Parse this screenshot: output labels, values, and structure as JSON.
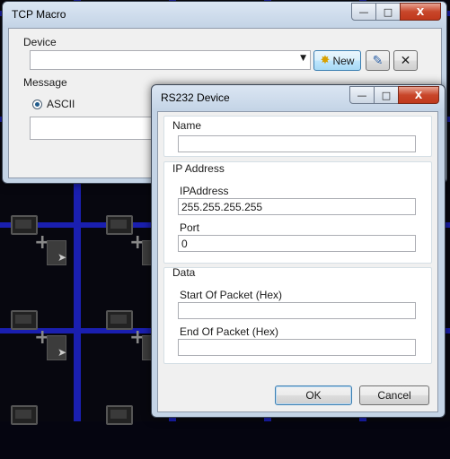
{
  "tcp_window": {
    "title": "TCP Macro",
    "device_label": "Device",
    "device_value": "",
    "new_button_label": "New",
    "message_label": "Message",
    "ascii_label": "ASCII",
    "message_value": ""
  },
  "rs232_dialog": {
    "title": "RS232 Device",
    "name_label": "Name",
    "name_value": "",
    "ip_group_label": "IP Address",
    "ipaddress_label": "IPAddress",
    "ipaddress_value": "255.255.255.255",
    "port_label": "Port",
    "port_value": "0",
    "data_group_label": "Data",
    "start_label": "Start Of Packet (Hex)",
    "start_value": "",
    "end_label": "End Of Packet (Hex)",
    "end_value": "",
    "ok_label": "OK",
    "cancel_label": "Cancel"
  },
  "window_controls": {
    "minimize": "—",
    "maximize": "□",
    "close": "X"
  },
  "colors": {
    "background": "#07070f",
    "grid_accent": "#1a1fb0",
    "window_frame": "#c4d4e6",
    "close_button": "#c8462a"
  }
}
